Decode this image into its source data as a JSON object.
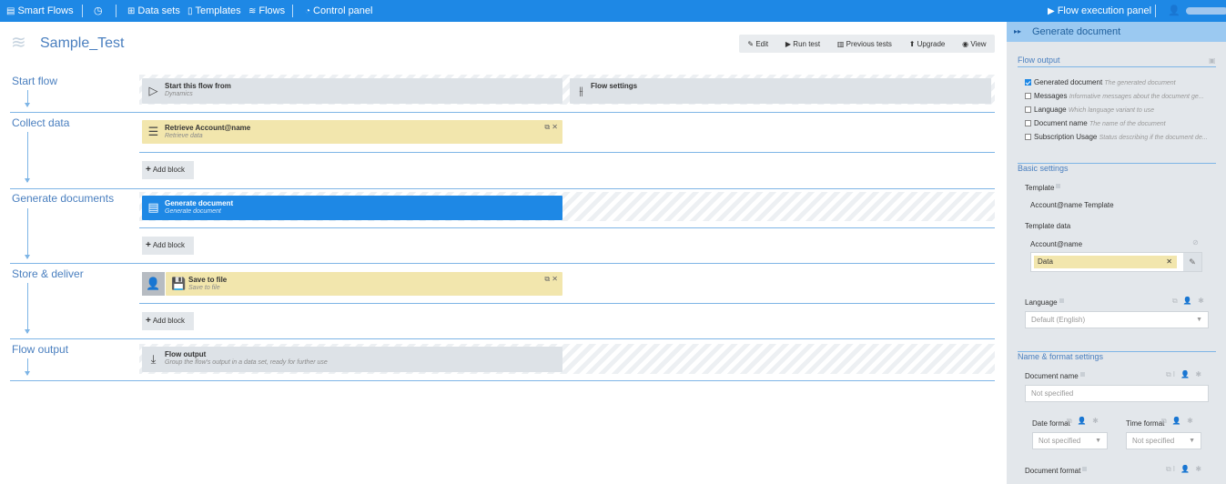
{
  "topbar": {
    "brand": "Smart Flows",
    "history_icon": "clock-icon",
    "datasets": "Data sets",
    "templates": "Templates",
    "flows": "Flows",
    "control_panel": "Control panel",
    "execution_panel": "Flow execution panel",
    "user_icon": "user-icon"
  },
  "page": {
    "title": "Sample_Test",
    "actions": [
      "Edit",
      "Run test",
      "Previous tests",
      "Upgrade",
      "View"
    ]
  },
  "stages": {
    "start": "Start flow",
    "collect": "Collect data",
    "generate": "Generate documents",
    "store": "Store & deliver",
    "output": "Flow output"
  },
  "blocks": {
    "start_from": {
      "title": "Start this flow from",
      "sub": "Dynamics"
    },
    "flow_settings": {
      "title": "Flow settings"
    },
    "retrieve": {
      "title": "Retrieve Account@name",
      "sub": "Retrieve data"
    },
    "generate": {
      "title": "Generate document",
      "sub": "Generate document"
    },
    "save": {
      "title": "Save to file",
      "sub": "Save to file"
    },
    "flow_output": {
      "title": "Flow output",
      "sub": "Group the flow's output in a data set, ready for further use"
    }
  },
  "add_block": "Add block",
  "panel": {
    "title": "Generate document",
    "flow_output_title": "Flow output",
    "outputs": [
      {
        "label": "Generated document",
        "desc": "The generated document",
        "checked": true
      },
      {
        "label": "Messages",
        "desc": "Informative messages about the document ge...",
        "checked": false
      },
      {
        "label": "Language",
        "desc": "Which language variant to use",
        "checked": false
      },
      {
        "label": "Document name",
        "desc": "The name of the document",
        "checked": false
      },
      {
        "label": "Subscription Usage",
        "desc": "Status describing if the document de...",
        "checked": false
      }
    ],
    "basic_title": "Basic settings",
    "template_label": "Template",
    "template_value": "Account@name Template",
    "template_data_label": "Template data",
    "account_label": "Account@name",
    "data_tag": "Data",
    "language_label": "Language",
    "language_value": "Default (English)",
    "name_format_title": "Name & format settings",
    "document_name_label": "Document name",
    "document_name_placeholder": "Not specified",
    "date_format_label": "Date format",
    "date_format_value": "Not specified",
    "time_format_label": "Time format",
    "time_format_value": "Not specified",
    "document_format_label": "Document format"
  },
  "colors": {
    "primary": "#1e88e5",
    "block_yellow": "#f2e6ad",
    "block_gray": "#dde2e7",
    "panel_bg": "#e3e7eb",
    "panel_head": "#9bc9f1"
  }
}
